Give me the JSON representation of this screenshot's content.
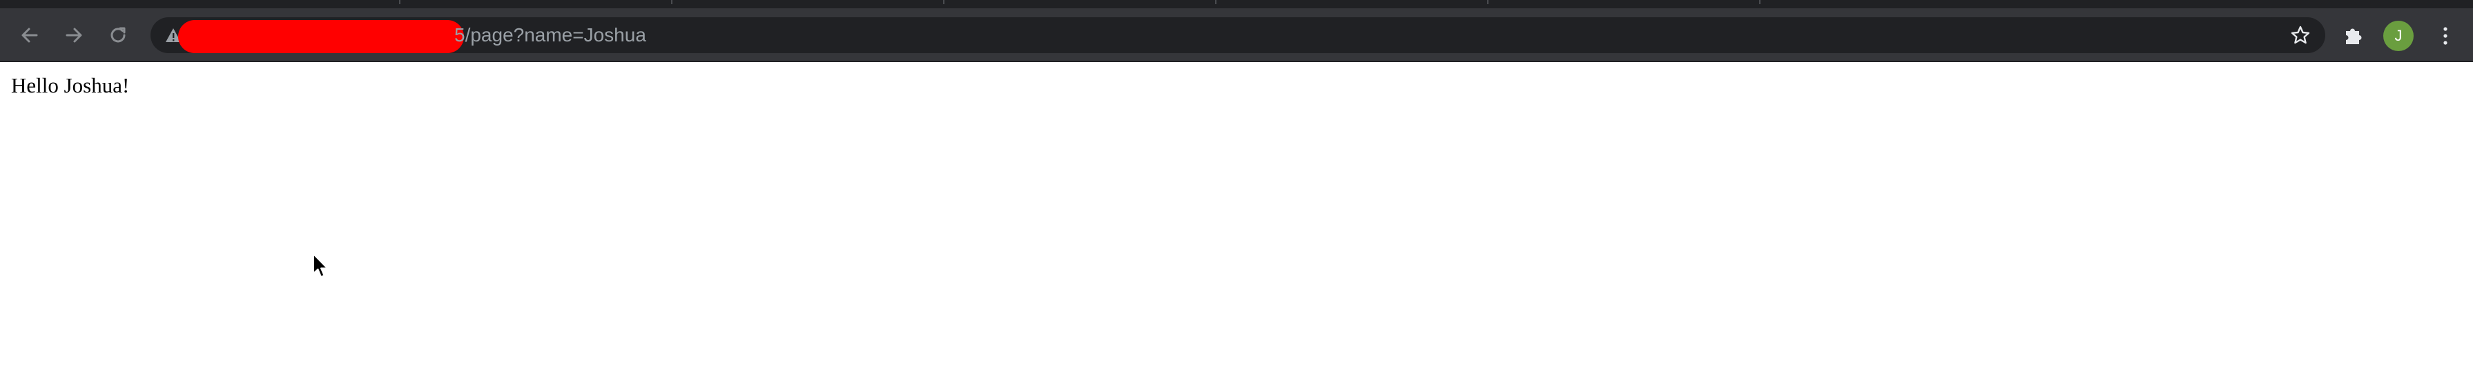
{
  "browser": {
    "address_bar": {
      "url_visible": "5/page?name=Joshua",
      "security_icon": "warning-triangle-icon"
    },
    "toolbar": {
      "back_icon": "arrow-left-icon",
      "forward_icon": "arrow-right-icon",
      "reload_icon": "reload-icon",
      "bookmark_icon": "star-icon",
      "extensions_icon": "puzzle-icon",
      "menu_icon": "kebab-menu-icon"
    },
    "profile": {
      "initial": "J",
      "color": "#6a9e3f"
    },
    "colors": {
      "toolbar_bg": "#35363a",
      "omnibox_bg": "#202124",
      "url_text": "#9aa0a6",
      "redaction": "#ff0000"
    }
  },
  "page": {
    "greeting": "Hello Joshua!"
  }
}
